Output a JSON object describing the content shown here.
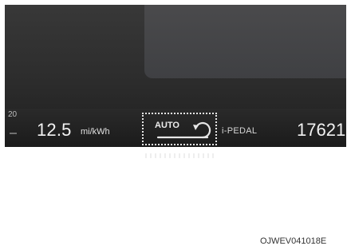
{
  "display": {
    "small_number": "20",
    "efficiency_value": "12.5",
    "efficiency_unit": "mi/kWh",
    "auto_label": "AUTO",
    "ipedal_label": "i-PEDAL",
    "odometer": "17621"
  },
  "figure_code": "OJWEV041018E",
  "icons": [
    "auto-regen-icon"
  ],
  "colors": {
    "display_bg": "#2c2c2c",
    "text": "#f2f2f2"
  }
}
